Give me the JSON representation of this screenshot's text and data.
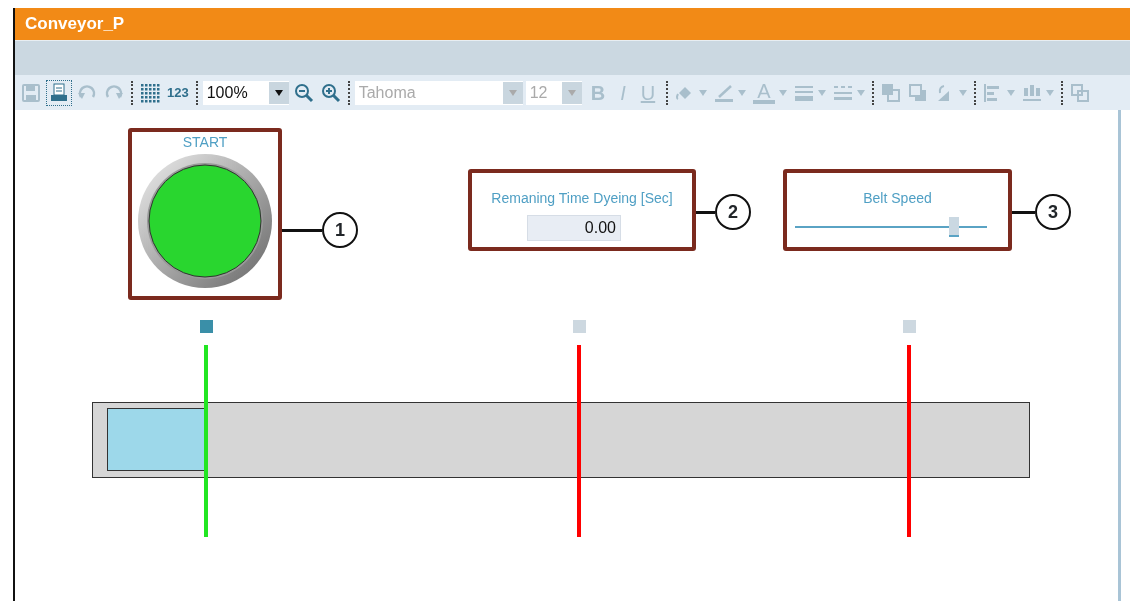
{
  "window": {
    "title": "Conveyor_P"
  },
  "toolbar": [
    {
      "kind": "save",
      "disabled": true
    },
    {
      "kind": "print",
      "disabled": false,
      "selected": true
    },
    {
      "kind": "undo",
      "disabled": true
    },
    {
      "kind": "redo",
      "disabled": true
    },
    {
      "kind": "separator"
    },
    {
      "kind": "grid",
      "disabled": false
    },
    {
      "kind": "label",
      "text": "123",
      "disabled": false
    },
    {
      "kind": "separator"
    },
    {
      "kind": "zoom-combo",
      "value": "100%",
      "disabled": false
    },
    {
      "kind": "zoom-out",
      "disabled": false
    },
    {
      "kind": "zoom-in",
      "disabled": false
    },
    {
      "kind": "separator"
    },
    {
      "kind": "font-combo",
      "value": "Tahoma",
      "disabled": true
    },
    {
      "kind": "size-combo",
      "value": "12",
      "disabled": true
    },
    {
      "kind": "bold",
      "text": "B",
      "disabled": true
    },
    {
      "kind": "italic",
      "text": "I",
      "disabled": true
    },
    {
      "kind": "underline",
      "text": "U",
      "disabled": true
    },
    {
      "kind": "separator"
    },
    {
      "kind": "fill",
      "disabled": true,
      "menu": true
    },
    {
      "kind": "pen",
      "disabled": true,
      "menu": true
    },
    {
      "kind": "font-color",
      "text": "A",
      "disabled": true,
      "menu": true
    },
    {
      "kind": "line-width",
      "disabled": true,
      "menu": true
    },
    {
      "kind": "dash",
      "disabled": true,
      "menu": true
    },
    {
      "kind": "separator"
    },
    {
      "kind": "front",
      "disabled": true
    },
    {
      "kind": "back",
      "disabled": true
    },
    {
      "kind": "rotate",
      "disabled": true,
      "menu": true
    },
    {
      "kind": "separator"
    },
    {
      "kind": "align",
      "disabled": true,
      "menu": true
    },
    {
      "kind": "distribute",
      "disabled": true,
      "menu": true
    },
    {
      "kind": "separator"
    },
    {
      "kind": "group",
      "disabled": true
    }
  ],
  "canvas": {
    "start_button": {
      "label": "START",
      "on": true,
      "callout": "1"
    },
    "time_display": {
      "label": "Remaning Time Dyeing [Sec]",
      "value": "0.00",
      "callout": "2"
    },
    "speed_slider": {
      "label": "Belt Speed",
      "level": 0.83,
      "callout": "3"
    },
    "sensors": [
      {
        "active": true,
        "color": "#22e622"
      },
      {
        "active": false,
        "color": "#ff0000"
      },
      {
        "active": false,
        "color": "#ff0000"
      }
    ]
  }
}
